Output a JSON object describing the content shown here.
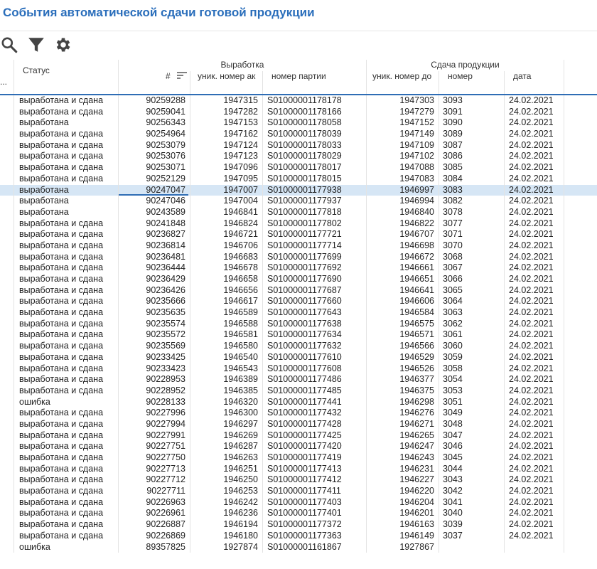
{
  "title": "События автоматической сдачи готовой продукции",
  "toolbar": {
    "icons": [
      "search-icon",
      "filter-icon",
      "settings-icon"
    ]
  },
  "columns": {
    "status": "Статус",
    "group_output": "Выработка",
    "group_delivery": "Сдача продукции",
    "num": "#",
    "uniq_act": "уник. номер ак",
    "batch": "номер партии",
    "uniq_doc": "уник. номер до",
    "number": "номер",
    "date": "дата",
    "more": "..."
  },
  "colors": {
    "title": "#2a6ebb",
    "selected_row": "#d6e6f5",
    "accent_line": "#2f6db5"
  },
  "rows": [
    [
      "выработана и сдана",
      "90259288",
      "1947315",
      "S01000001178178",
      "1947303",
      "3093",
      "24.02.2021"
    ],
    [
      "выработана и сдана",
      "90259041",
      "1947282",
      "S01000001178166",
      "1947279",
      "3091",
      "24.02.2021"
    ],
    [
      "выработана",
      "90256343",
      "1947153",
      "S01000001178058",
      "1947152",
      "3090",
      "24.02.2021"
    ],
    [
      "выработана и сдана",
      "90254964",
      "1947162",
      "S01000001178039",
      "1947149",
      "3089",
      "24.02.2021"
    ],
    [
      "выработана и сдана",
      "90253079",
      "1947124",
      "S01000001178033",
      "1947109",
      "3087",
      "24.02.2021"
    ],
    [
      "выработана и сдана",
      "90253076",
      "1947123",
      "S01000001178029",
      "1947102",
      "3086",
      "24.02.2021"
    ],
    [
      "выработана и сдана",
      "90253071",
      "1947096",
      "S01000001178017",
      "1947088",
      "3085",
      "24.02.2021"
    ],
    [
      "выработана и сдана",
      "90252129",
      "1947095",
      "S01000001178015",
      "1947083",
      "3084",
      "24.02.2021"
    ],
    [
      "выработана",
      "90247047",
      "1947007",
      "S01000001177938",
      "1946997",
      "3083",
      "24.02.2021"
    ],
    [
      "выработана",
      "90247046",
      "1947004",
      "S01000001177937",
      "1946994",
      "3082",
      "24.02.2021"
    ],
    [
      "выработана",
      "90243589",
      "1946841",
      "S01000001177818",
      "1946840",
      "3078",
      "24.02.2021"
    ],
    [
      "выработана и сдана",
      "90241848",
      "1946824",
      "S01000001177802",
      "1946822",
      "3077",
      "24.02.2021"
    ],
    [
      "выработана и сдана",
      "90236827",
      "1946721",
      "S01000001177721",
      "1946707",
      "3071",
      "24.02.2021"
    ],
    [
      "выработана и сдана",
      "90236814",
      "1946706",
      "S01000001177714",
      "1946698",
      "3070",
      "24.02.2021"
    ],
    [
      "выработана и сдана",
      "90236481",
      "1946683",
      "S01000001177699",
      "1946672",
      "3068",
      "24.02.2021"
    ],
    [
      "выработана и сдана",
      "90236444",
      "1946678",
      "S01000001177692",
      "1946661",
      "3067",
      "24.02.2021"
    ],
    [
      "выработана и сдана",
      "90236429",
      "1946658",
      "S01000001177690",
      "1946651",
      "3066",
      "24.02.2021"
    ],
    [
      "выработана и сдана",
      "90236426",
      "1946656",
      "S01000001177687",
      "1946641",
      "3065",
      "24.02.2021"
    ],
    [
      "выработана и сдана",
      "90235666",
      "1946617",
      "S01000001177660",
      "1946606",
      "3064",
      "24.02.2021"
    ],
    [
      "выработана и сдана",
      "90235635",
      "1946589",
      "S01000001177643",
      "1946584",
      "3063",
      "24.02.2021"
    ],
    [
      "выработана и сдана",
      "90235574",
      "1946588",
      "S01000001177638",
      "1946575",
      "3062",
      "24.02.2021"
    ],
    [
      "выработана и сдана",
      "90235572",
      "1946581",
      "S01000001177634",
      "1946571",
      "3061",
      "24.02.2021"
    ],
    [
      "выработана и сдана",
      "90235569",
      "1946580",
      "S01000001177632",
      "1946566",
      "3060",
      "24.02.2021"
    ],
    [
      "выработана и сдана",
      "90233425",
      "1946540",
      "S01000001177610",
      "1946529",
      "3059",
      "24.02.2021"
    ],
    [
      "выработана и сдана",
      "90233423",
      "1946543",
      "S01000001177608",
      "1946526",
      "3058",
      "24.02.2021"
    ],
    [
      "выработана и сдана",
      "90228953",
      "1946389",
      "S01000001177486",
      "1946377",
      "3054",
      "24.02.2021"
    ],
    [
      "выработана и сдана",
      "90228952",
      "1946385",
      "S01000001177485",
      "1946375",
      "3053",
      "24.02.2021"
    ],
    [
      "ошибка",
      "90228133",
      "1946320",
      "S01000001177441",
      "1946298",
      "3051",
      "24.02.2021"
    ],
    [
      "выработана и сдана",
      "90227996",
      "1946300",
      "S01000001177432",
      "1946276",
      "3049",
      "24.02.2021"
    ],
    [
      "выработана и сдана",
      "90227994",
      "1946297",
      "S01000001177428",
      "1946271",
      "3048",
      "24.02.2021"
    ],
    [
      "выработана и сдана",
      "90227991",
      "1946269",
      "S01000001177425",
      "1946265",
      "3047",
      "24.02.2021"
    ],
    [
      "выработана и сдана",
      "90227751",
      "1946287",
      "S01000001177420",
      "1946247",
      "3046",
      "24.02.2021"
    ],
    [
      "выработана и сдана",
      "90227750",
      "1946263",
      "S01000001177419",
      "1946243",
      "3045",
      "24.02.2021"
    ],
    [
      "выработана и сдана",
      "90227713",
      "1946251",
      "S01000001177413",
      "1946231",
      "3044",
      "24.02.2021"
    ],
    [
      "выработана и сдана",
      "90227712",
      "1946250",
      "S01000001177412",
      "1946227",
      "3043",
      "24.02.2021"
    ],
    [
      "выработана и сдана",
      "90227711",
      "1946253",
      "S01000001177411",
      "1946220",
      "3042",
      "24.02.2021"
    ],
    [
      "выработана и сдана",
      "90226963",
      "1946242",
      "S01000001177403",
      "1946204",
      "3041",
      "24.02.2021"
    ],
    [
      "выработана и сдана",
      "90226961",
      "1946236",
      "S01000001177401",
      "1946201",
      "3040",
      "24.02.2021"
    ],
    [
      "выработана и сдана",
      "90226887",
      "1946194",
      "S01000001177372",
      "1946163",
      "3039",
      "24.02.2021"
    ],
    [
      "выработана и сдана",
      "90226869",
      "1946180",
      "S01000001177363",
      "1946149",
      "3037",
      "24.02.2021"
    ],
    [
      "ошибка",
      "89357825",
      "1927874",
      "S01000001161867",
      "1927867",
      "",
      ""
    ]
  ],
  "selected_row_index": 8
}
